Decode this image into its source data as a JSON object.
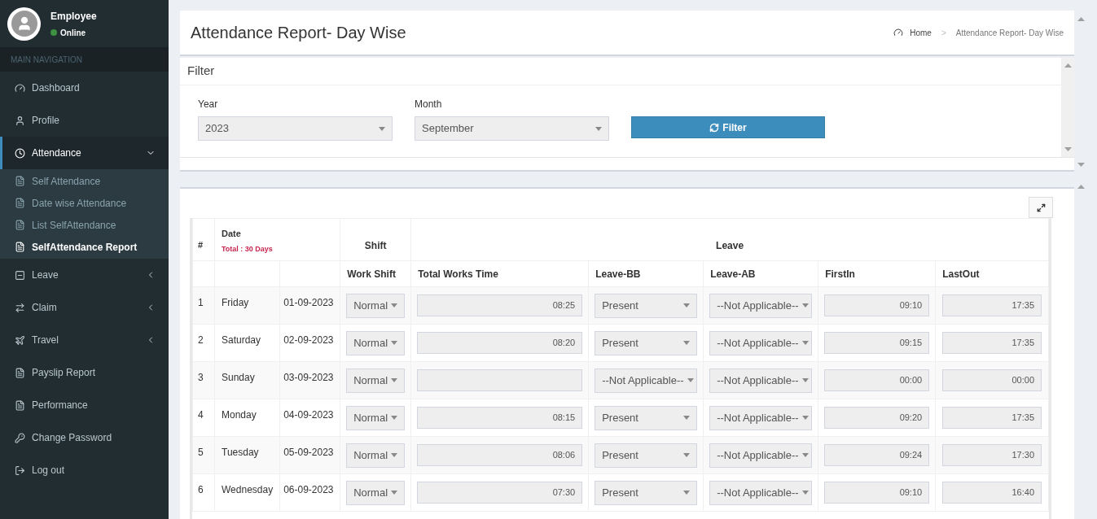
{
  "user": {
    "name": "Employee",
    "status": "Online",
    "online": true
  },
  "nav_header": "MAIN NAVIGATION",
  "nav": [
    {
      "label": "Dashboard",
      "selected": false
    },
    {
      "label": "Profile",
      "selected": false
    },
    {
      "label": "Attendance",
      "selected": true,
      "expanded": true,
      "children": [
        {
          "label": "Self Attendance",
          "selected": false
        },
        {
          "label": "Date wise Attendance",
          "selected": false
        },
        {
          "label": "List SelfAttendance",
          "selected": false
        },
        {
          "label": "SelfAttendance Report",
          "selected": true
        }
      ]
    },
    {
      "label": "Leave",
      "selected": false,
      "expanded": false
    },
    {
      "label": "Claim",
      "selected": false,
      "expanded": false
    },
    {
      "label": "Travel",
      "selected": false,
      "expanded": false
    },
    {
      "label": "Payslip Report",
      "selected": false
    },
    {
      "label": "Performance",
      "selected": false
    },
    {
      "label": "Change Password",
      "selected": false
    },
    {
      "label": "Log out",
      "selected": false
    }
  ],
  "page_title": "Attendance Report- Day Wise",
  "breadcrumb": [
    "Home",
    ">",
    "Attendance Report- Day Wise"
  ],
  "filter": {
    "title": "Filter",
    "fields": [
      {
        "label": "Year",
        "value": "2023"
      },
      {
        "label": "Month",
        "value": "September"
      }
    ],
    "button": "Filter"
  },
  "table": {
    "head": {
      "number": "#",
      "date": "Date",
      "total": "Total : 30 Days",
      "shift": "Shift",
      "leave": "Leave"
    },
    "columns": [
      "Work Shift",
      "Total Works Time",
      "Leave-BB",
      "Leave-AB",
      "FirstIn",
      "LastOut"
    ],
    "rows": [
      {
        "no": "1",
        "day": "Friday",
        "date": "01-09-2023",
        "shift": "Normal",
        "total": "08:25",
        "leave_bb": "Present",
        "leave_ab": "--Not Applicable--",
        "first_in": "09:10",
        "last_out": "17:35"
      },
      {
        "no": "2",
        "day": "Saturday",
        "date": "02-09-2023",
        "shift": "Normal",
        "total": "08:20",
        "leave_bb": "Present",
        "leave_ab": "--Not Applicable--",
        "first_in": "09:15",
        "last_out": "17:35"
      },
      {
        "no": "3",
        "day": "Sunday",
        "date": "03-09-2023",
        "shift": "Normal",
        "leave_bb": "--Not Applicable--",
        "leave_ab": "--Not Applicable--",
        "first_in": "00:00",
        "last_out": "00:00"
      },
      {
        "no": "4",
        "day": "Monday",
        "date": "04-09-2023",
        "shift": "Normal",
        "total": "08:15",
        "leave_bb": "Present",
        "leave_ab": "--Not Applicable--",
        "first_in": "09:20",
        "last_out": "17:35"
      },
      {
        "no": "5",
        "day": "Tuesday",
        "date": "05-09-2023",
        "shift": "Normal",
        "total": "08:06",
        "leave_bb": "Present",
        "leave_ab": "--Not Applicable--",
        "first_in": "09:24",
        "last_out": "17:30"
      },
      {
        "no": "6",
        "day": "Wednesday",
        "date": "06-09-2023",
        "shift": "Normal",
        "total": "07:30",
        "leave_bb": "Present",
        "leave_ab": "--Not Applicable--",
        "first_in": "09:10",
        "last_out": "16:40"
      }
    ]
  }
}
